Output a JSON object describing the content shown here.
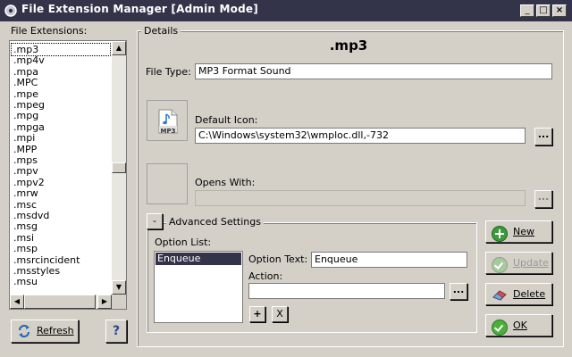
{
  "window": {
    "title": "File Extension Manager [Admin Mode]",
    "minimize": "_",
    "maximize": "□",
    "close": "×"
  },
  "sidebar": {
    "label": "File Extensions:",
    "items": [
      ".mp3",
      ".mp4v",
      ".mpa",
      ".MPC",
      ".mpe",
      ".mpeg",
      ".mpg",
      ".mpga",
      ".mpi",
      ".MPP",
      ".mps",
      ".mpv",
      ".mpv2",
      ".mrw",
      ".msc",
      ".msdvd",
      ".msg",
      ".msi",
      ".msp",
      ".msrcincident",
      ".msstyles",
      ".msu"
    ],
    "selected_index": 0,
    "refresh_label": "Refresh",
    "help_label": "?"
  },
  "details": {
    "group_label": "Details",
    "extension": ".mp3",
    "file_type_label": "File Type:",
    "file_type_value": "MP3 Format Sound",
    "default_icon_label": "Default Icon:",
    "default_icon_value": "C:\\Windows\\system32\\wmploc.dll,-732",
    "icon_caption": "MP3",
    "opens_with_label": "Opens With:",
    "opens_with_value": "",
    "browse_label": "..."
  },
  "advanced": {
    "toggle_label": "-",
    "group_label": "Advanced Settings",
    "option_list_label": "Option List:",
    "options": [
      "Enqueue"
    ],
    "option_text_label": "Option Text:",
    "option_text_value": "Enqueue",
    "action_label": "Action:",
    "action_value": "",
    "browse_label": "...",
    "add_label": "+",
    "remove_label": "X"
  },
  "actions": {
    "new_label": "New",
    "update_label": "Update",
    "delete_label": "Delete",
    "ok_label": "OK"
  },
  "colors": {
    "titlebar": "#33334a",
    "face": "#d4d0c8",
    "new_icon": "#3c9a3c",
    "ok_icon": "#4caf3c",
    "update_icon": "#a8c8a0",
    "delete_icon": "#d05050"
  }
}
